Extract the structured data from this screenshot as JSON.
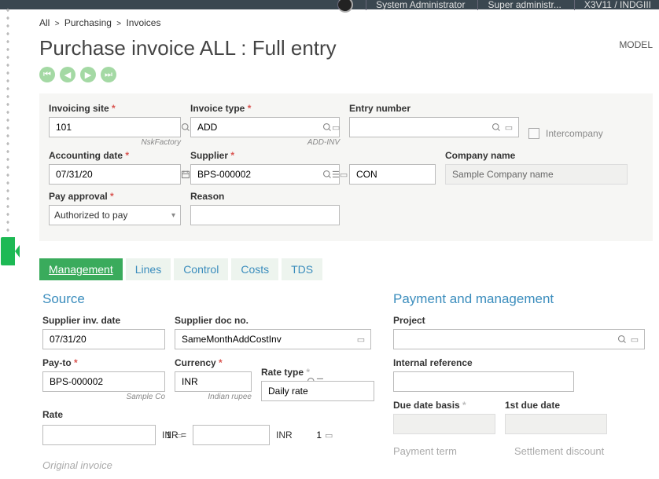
{
  "topbar": {
    "user": "System Administrator",
    "role": "Super administr...",
    "env": "X3V11 / INDGIII"
  },
  "breadcrumb": {
    "a": "All",
    "b": "Purchasing",
    "c": "Invoices"
  },
  "title": "Purchase invoice ALL : Full entry",
  "model": "MODEL",
  "header": {
    "invoicing_site": {
      "label": "Invoicing site",
      "value": "101",
      "hint": "NskFactory"
    },
    "invoice_type": {
      "label": "Invoice type",
      "value": "ADD",
      "hint": "ADD-INV"
    },
    "entry_number": {
      "label": "Entry number",
      "value": ""
    },
    "intercompany": {
      "label": "Intercompany"
    },
    "accounting_date": {
      "label": "Accounting date",
      "value": "07/31/20"
    },
    "supplier": {
      "label": "Supplier",
      "value": "BPS-000002"
    },
    "supplier_code": {
      "value": "CON"
    },
    "company_name": {
      "label": "Company name",
      "value": "Sample Company name"
    },
    "pay_approval": {
      "label": "Pay approval",
      "value": "Authorized to pay"
    },
    "reason": {
      "label": "Reason",
      "value": ""
    }
  },
  "tabs": {
    "t1": "Management",
    "t2": "Lines",
    "t3": "Control",
    "t4": "Costs",
    "t5": "TDS"
  },
  "mgmt": {
    "source_h": "Source",
    "pay_h": "Payment and management",
    "supplier_inv_date": {
      "label": "Supplier inv. date",
      "value": "07/31/20"
    },
    "supplier_doc_no": {
      "label": "Supplier doc no.",
      "value": "SameMonthAddCostInv"
    },
    "payto": {
      "label": "Pay-to",
      "value": "BPS-000002",
      "hint": "Sample Co"
    },
    "currency": {
      "label": "Currency",
      "value": "INR",
      "hint": "Indian rupee"
    },
    "rate_type": {
      "label": "Rate type",
      "value": "Daily rate"
    },
    "rate": {
      "label": "Rate",
      "value": "1"
    },
    "rate_eq": {
      "prefix": "INR =",
      "value": "1",
      "suffix": "INR"
    },
    "original_invoice": "Original invoice",
    "project": {
      "label": "Project",
      "value": ""
    },
    "internal_ref": {
      "label": "Internal reference",
      "value": ""
    },
    "due_date_basis": {
      "label": "Due date basis",
      "value": ""
    },
    "first_due": {
      "label": "1st due date",
      "value": ""
    },
    "payment_term": "Payment term",
    "settlement_discount": "Settlement discount"
  }
}
